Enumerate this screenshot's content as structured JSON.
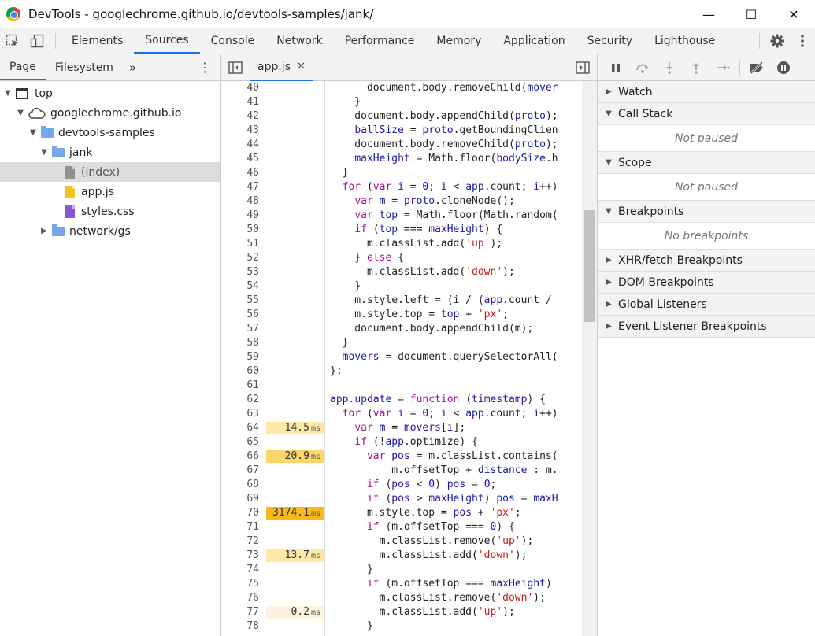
{
  "window": {
    "title": "DevTools - googlechrome.github.io/devtools-samples/jank/",
    "minimize": "—",
    "maximize": "☐",
    "close": "✕"
  },
  "toolbar": {
    "tabs": [
      "Elements",
      "Sources",
      "Console",
      "Network",
      "Performance",
      "Memory",
      "Application",
      "Security",
      "Lighthouse"
    ],
    "active_tab": "Sources"
  },
  "navigator": {
    "tabs": [
      "Page",
      "Filesystem"
    ],
    "more": "»",
    "menu": "⋮",
    "tree": {
      "top": "top",
      "domain": "googlechrome.github.io",
      "folder1": "devtools-samples",
      "folder2": "jank",
      "file_index": "(index)",
      "file_app": "app.js",
      "file_styles": "styles.css",
      "folder3": "network/gs"
    }
  },
  "editor": {
    "tab_label": "app.js",
    "close": "✕",
    "line_numbers": [
      "40",
      "41",
      "42",
      "43",
      "44",
      "45",
      "46",
      "47",
      "48",
      "49",
      "50",
      "51",
      "52",
      "53",
      "54",
      "55",
      "56",
      "57",
      "58",
      "59",
      "60",
      "61",
      "62",
      "63",
      "64",
      "65",
      "66",
      "67",
      "68",
      "69",
      "70",
      "71",
      "72",
      "73",
      "74",
      "75",
      "76",
      "77",
      "78"
    ],
    "timings": {
      "l64": "14.5",
      "l66": "20.9",
      "l70": "3174.1",
      "l73": "13.7",
      "l77": "0.2",
      "unit": "ms"
    }
  },
  "colors": {
    "accent": "#1a73e8",
    "perf_light": "#ffe8a6",
    "perf_mid": "#fdd56b",
    "perf_hot": "#f9b919",
    "perf_faint": "#fdf3e1"
  },
  "debugger": {
    "watch": "Watch",
    "callstack": "Call Stack",
    "callstack_empty": "Not paused",
    "scope": "Scope",
    "scope_empty": "Not paused",
    "breakpoints": "Breakpoints",
    "breakpoints_empty": "No breakpoints",
    "xhr": "XHR/fetch Breakpoints",
    "dom": "DOM Breakpoints",
    "global": "Global Listeners",
    "event": "Event Listener Breakpoints"
  }
}
